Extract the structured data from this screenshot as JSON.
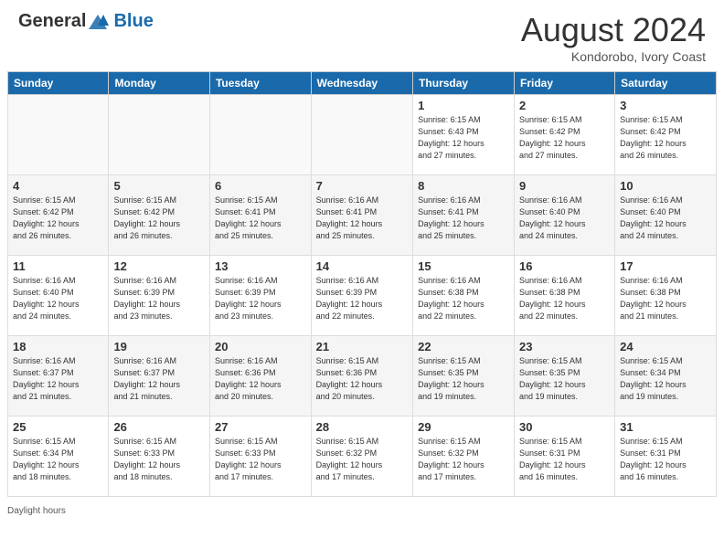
{
  "header": {
    "logo": {
      "general": "General",
      "blue": "Blue"
    },
    "title": "August 2024",
    "location": "Kondorobo, Ivory Coast"
  },
  "days_of_week": [
    "Sunday",
    "Monday",
    "Tuesday",
    "Wednesday",
    "Thursday",
    "Friday",
    "Saturday"
  ],
  "footnote": "Daylight hours",
  "weeks": [
    [
      {
        "day": "",
        "info": ""
      },
      {
        "day": "",
        "info": ""
      },
      {
        "day": "",
        "info": ""
      },
      {
        "day": "",
        "info": ""
      },
      {
        "day": "1",
        "info": "Sunrise: 6:15 AM\nSunset: 6:43 PM\nDaylight: 12 hours\nand 27 minutes."
      },
      {
        "day": "2",
        "info": "Sunrise: 6:15 AM\nSunset: 6:42 PM\nDaylight: 12 hours\nand 27 minutes."
      },
      {
        "day": "3",
        "info": "Sunrise: 6:15 AM\nSunset: 6:42 PM\nDaylight: 12 hours\nand 26 minutes."
      }
    ],
    [
      {
        "day": "4",
        "info": "Sunrise: 6:15 AM\nSunset: 6:42 PM\nDaylight: 12 hours\nand 26 minutes."
      },
      {
        "day": "5",
        "info": "Sunrise: 6:15 AM\nSunset: 6:42 PM\nDaylight: 12 hours\nand 26 minutes."
      },
      {
        "day": "6",
        "info": "Sunrise: 6:15 AM\nSunset: 6:41 PM\nDaylight: 12 hours\nand 25 minutes."
      },
      {
        "day": "7",
        "info": "Sunrise: 6:16 AM\nSunset: 6:41 PM\nDaylight: 12 hours\nand 25 minutes."
      },
      {
        "day": "8",
        "info": "Sunrise: 6:16 AM\nSunset: 6:41 PM\nDaylight: 12 hours\nand 25 minutes."
      },
      {
        "day": "9",
        "info": "Sunrise: 6:16 AM\nSunset: 6:40 PM\nDaylight: 12 hours\nand 24 minutes."
      },
      {
        "day": "10",
        "info": "Sunrise: 6:16 AM\nSunset: 6:40 PM\nDaylight: 12 hours\nand 24 minutes."
      }
    ],
    [
      {
        "day": "11",
        "info": "Sunrise: 6:16 AM\nSunset: 6:40 PM\nDaylight: 12 hours\nand 24 minutes."
      },
      {
        "day": "12",
        "info": "Sunrise: 6:16 AM\nSunset: 6:39 PM\nDaylight: 12 hours\nand 23 minutes."
      },
      {
        "day": "13",
        "info": "Sunrise: 6:16 AM\nSunset: 6:39 PM\nDaylight: 12 hours\nand 23 minutes."
      },
      {
        "day": "14",
        "info": "Sunrise: 6:16 AM\nSunset: 6:39 PM\nDaylight: 12 hours\nand 22 minutes."
      },
      {
        "day": "15",
        "info": "Sunrise: 6:16 AM\nSunset: 6:38 PM\nDaylight: 12 hours\nand 22 minutes."
      },
      {
        "day": "16",
        "info": "Sunrise: 6:16 AM\nSunset: 6:38 PM\nDaylight: 12 hours\nand 22 minutes."
      },
      {
        "day": "17",
        "info": "Sunrise: 6:16 AM\nSunset: 6:38 PM\nDaylight: 12 hours\nand 21 minutes."
      }
    ],
    [
      {
        "day": "18",
        "info": "Sunrise: 6:16 AM\nSunset: 6:37 PM\nDaylight: 12 hours\nand 21 minutes."
      },
      {
        "day": "19",
        "info": "Sunrise: 6:16 AM\nSunset: 6:37 PM\nDaylight: 12 hours\nand 21 minutes."
      },
      {
        "day": "20",
        "info": "Sunrise: 6:16 AM\nSunset: 6:36 PM\nDaylight: 12 hours\nand 20 minutes."
      },
      {
        "day": "21",
        "info": "Sunrise: 6:15 AM\nSunset: 6:36 PM\nDaylight: 12 hours\nand 20 minutes."
      },
      {
        "day": "22",
        "info": "Sunrise: 6:15 AM\nSunset: 6:35 PM\nDaylight: 12 hours\nand 19 minutes."
      },
      {
        "day": "23",
        "info": "Sunrise: 6:15 AM\nSunset: 6:35 PM\nDaylight: 12 hours\nand 19 minutes."
      },
      {
        "day": "24",
        "info": "Sunrise: 6:15 AM\nSunset: 6:34 PM\nDaylight: 12 hours\nand 19 minutes."
      }
    ],
    [
      {
        "day": "25",
        "info": "Sunrise: 6:15 AM\nSunset: 6:34 PM\nDaylight: 12 hours\nand 18 minutes."
      },
      {
        "day": "26",
        "info": "Sunrise: 6:15 AM\nSunset: 6:33 PM\nDaylight: 12 hours\nand 18 minutes."
      },
      {
        "day": "27",
        "info": "Sunrise: 6:15 AM\nSunset: 6:33 PM\nDaylight: 12 hours\nand 17 minutes."
      },
      {
        "day": "28",
        "info": "Sunrise: 6:15 AM\nSunset: 6:32 PM\nDaylight: 12 hours\nand 17 minutes."
      },
      {
        "day": "29",
        "info": "Sunrise: 6:15 AM\nSunset: 6:32 PM\nDaylight: 12 hours\nand 17 minutes."
      },
      {
        "day": "30",
        "info": "Sunrise: 6:15 AM\nSunset: 6:31 PM\nDaylight: 12 hours\nand 16 minutes."
      },
      {
        "day": "31",
        "info": "Sunrise: 6:15 AM\nSunset: 6:31 PM\nDaylight: 12 hours\nand 16 minutes."
      }
    ]
  ]
}
